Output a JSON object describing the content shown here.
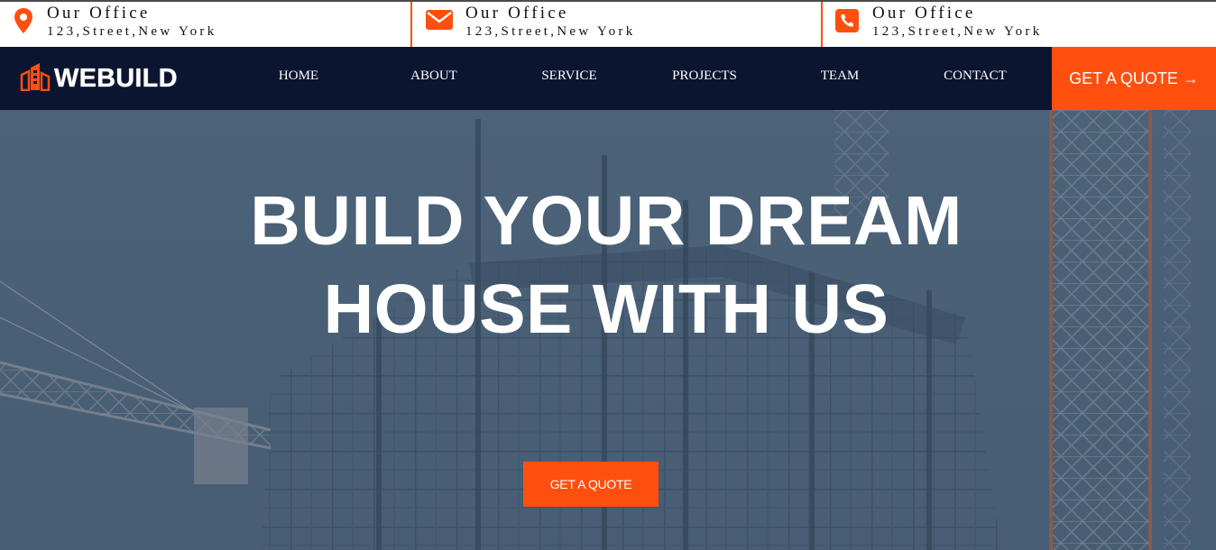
{
  "topbar": {
    "items": [
      {
        "icon": "map-pin-icon",
        "title": "Our Office",
        "address": "123,Street,New York"
      },
      {
        "icon": "envelope-icon",
        "title": "Our Office",
        "address": "123,Street,New York"
      },
      {
        "icon": "phone-icon",
        "title": "Our Office",
        "address": "123,Street,New York"
      }
    ]
  },
  "navbar": {
    "brand": "WEBUILD",
    "brand_icon": "building-logo-icon",
    "items": [
      {
        "label": "HOME"
      },
      {
        "label": "ABOUT"
      },
      {
        "label": "SERVICE"
      },
      {
        "label": "PROJECTS"
      },
      {
        "label": "TEAM"
      },
      {
        "label": "CONTACT"
      }
    ],
    "quote_button": "GET A QUOTE →"
  },
  "hero": {
    "title_line1": "BUILD YOUR DREAM",
    "title_line2": "HOUSE WITH US",
    "button": "GET A QUOTE"
  },
  "colors": {
    "accent": "#ff4f0f",
    "navbar_bg": "#0b1530",
    "hero_overlay": "#4a6078",
    "text_light": "#ffffff",
    "text_dark": "#111111"
  }
}
